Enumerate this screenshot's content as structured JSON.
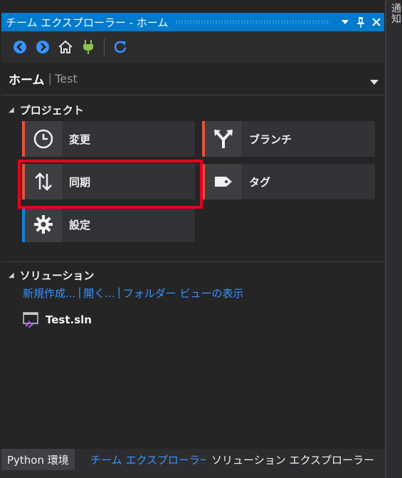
{
  "side_tab": {
    "label": "通知"
  },
  "window": {
    "title": "チーム エクスプローラー - ホーム",
    "buttons": {
      "dropdown": "▼",
      "pin": "pin",
      "close": "✕"
    }
  },
  "toolbar": {
    "icons": [
      "back-icon",
      "forward-icon",
      "home-icon",
      "connect-icon",
      "refresh-icon"
    ]
  },
  "header": {
    "title": "ホーム",
    "separator": "|",
    "project": "Test"
  },
  "project_section": {
    "title": "プロジェクト",
    "tiles": [
      {
        "label": "変更",
        "icon": "clock-icon",
        "accent": "#e0533b"
      },
      {
        "label": "ブランチ",
        "icon": "branch-icon",
        "accent": "#e0533b"
      },
      {
        "label": "同期",
        "icon": "sync-icon",
        "accent": "#e0533b"
      },
      {
        "label": "タグ",
        "icon": "tag-icon",
        "accent": "#e0533b"
      },
      {
        "label": "設定",
        "icon": "gear-icon",
        "accent": "#1c7ed6"
      }
    ]
  },
  "solution_section": {
    "title": "ソリューション",
    "links": [
      "新規作成...",
      "開く...",
      "フォルダー ビューの表示"
    ],
    "link_separator": "|",
    "items": [
      {
        "name": "Test.sln",
        "icon": "solution-file-icon"
      }
    ]
  },
  "bottom_tabs": [
    {
      "label": "Python 環境"
    },
    {
      "label": "チーム エクスプローラー",
      "active": true
    },
    {
      "label": "ソリューション エクスプローラー"
    }
  ],
  "colors": {
    "accent_blue": "#007acc",
    "link": "#3794ff",
    "highlight": "#e8001c"
  }
}
